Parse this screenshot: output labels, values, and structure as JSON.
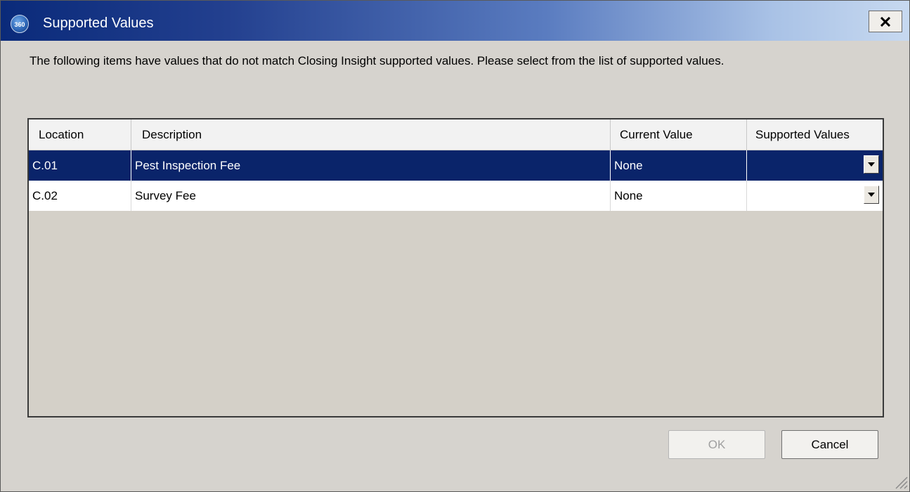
{
  "window": {
    "title": "Supported Values",
    "app_icon_text": "360",
    "close_symbol": "close-icon"
  },
  "message": "The following items have values that do not match Closing Insight supported values. Please select from the list of supported values.",
  "grid": {
    "columns": [
      "Location",
      "Description",
      "Current Value",
      "Supported Values"
    ],
    "rows": [
      {
        "location": "C.01",
        "description": "Pest Inspection Fee",
        "current_value": "None",
        "supported_value": "",
        "selected": true
      },
      {
        "location": "C.02",
        "description": "Survey Fee",
        "current_value": "None",
        "supported_value": "",
        "selected": false
      }
    ]
  },
  "buttons": {
    "ok_label": "OK",
    "cancel_label": "Cancel"
  },
  "colors": {
    "selection": "#0a246a",
    "dialog_background": "#d6d3ce"
  }
}
